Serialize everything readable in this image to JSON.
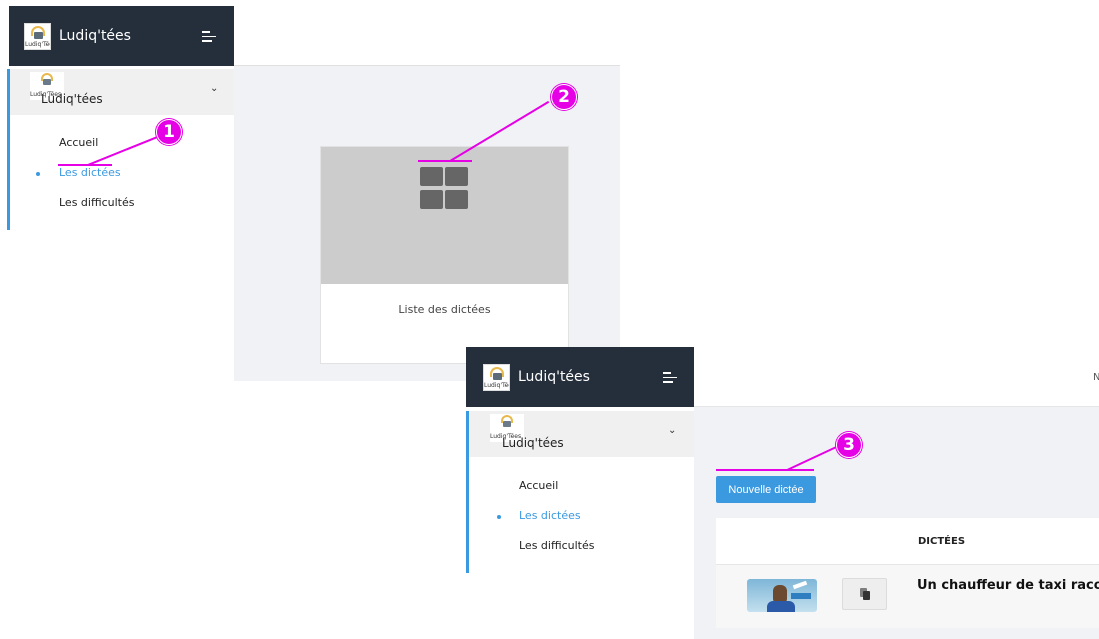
{
  "brand": {
    "name": "Ludiq'tées",
    "logo_text": "Ludiq'Tées"
  },
  "sidebar": {
    "title": "Ludiq'tées",
    "items": [
      {
        "label": "Accueil",
        "active": false
      },
      {
        "label": "Les dictées",
        "active": true
      },
      {
        "label": "Les difficultés",
        "active": false
      }
    ]
  },
  "card": {
    "caption": "Liste des dictées"
  },
  "markers": [
    "1",
    "2",
    "3"
  ],
  "toolbar": {
    "new_button": "Nouvelle dictée"
  },
  "table": {
    "column_header": "DICTÉES",
    "rows": [
      {
        "title": "Un chauffeur de taxi racont"
      }
    ]
  },
  "header_cut_text": "N",
  "icons": [
    "menu-icon",
    "chevron-down-icon",
    "grid-icon",
    "copy-icon"
  ],
  "colors": {
    "topbar": "#252f3c",
    "accent": "#3b99e0",
    "annotation": "#e600e6"
  }
}
